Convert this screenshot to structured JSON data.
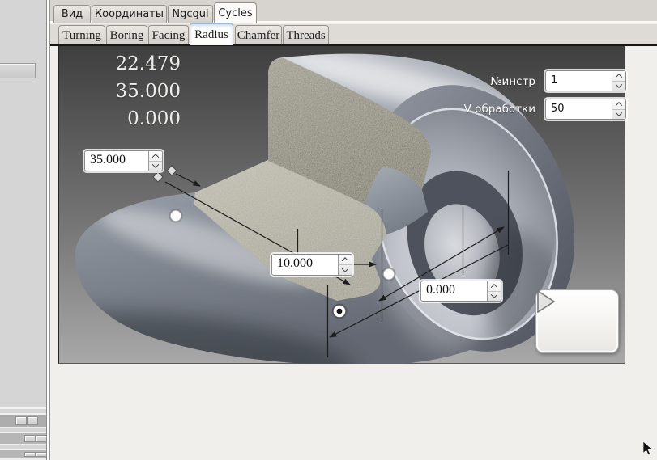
{
  "window_tabs": {
    "items": [
      {
        "label": "Вид"
      },
      {
        "label": "Координаты"
      },
      {
        "label": "Ngcgui"
      },
      {
        "label": "Cycles"
      }
    ],
    "active": "Cycles"
  },
  "cycle_tabs": {
    "items": [
      {
        "label": "Turning"
      },
      {
        "label": "Boring"
      },
      {
        "label": "Facing"
      },
      {
        "label": "Radius"
      },
      {
        "label": "Chamfer"
      },
      {
        "label": "Threads"
      }
    ],
    "active": "Radius"
  },
  "dro": {
    "values": [
      "22.479",
      "35.000",
      "0.000"
    ]
  },
  "dimension_inputs": {
    "length": {
      "value": "35.000"
    },
    "width": {
      "value": "10.000"
    },
    "offset": {
      "value": "0.000"
    }
  },
  "parameters": {
    "tool": {
      "label": "№инстр",
      "value": "1"
    },
    "speed": {
      "label": "V обработки",
      "value": "50"
    }
  },
  "icons": {
    "run": "play-icon",
    "spin_up": "chevron-up-icon",
    "spin_down": "chevron-down-icon"
  },
  "colors": {
    "viewport_top": "#3f3f3f",
    "viewport_bottom": "#a8a8a8",
    "page_bg": "#f1efeb",
    "panel_bg": "#d5d5d5",
    "annotation": "#1c1c1c",
    "active_tab_accent": "#9db8d2"
  }
}
